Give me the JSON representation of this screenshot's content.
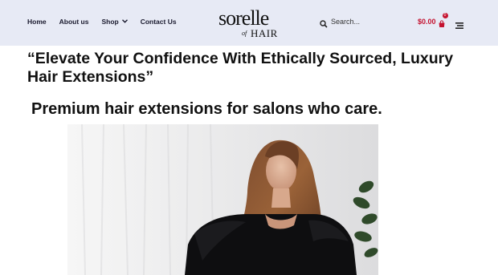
{
  "header": {
    "nav": [
      {
        "label": "Home"
      },
      {
        "label": "About us"
      },
      {
        "label": "Shop"
      },
      {
        "label": "Contact Us"
      }
    ],
    "logo": {
      "main": "sorelle",
      "of": "of",
      "hair": "HAIR"
    },
    "search": {
      "placeholder": "Search..."
    },
    "cart": {
      "amount": "$0.00",
      "count": "0"
    }
  },
  "main": {
    "quote": "“Elevate Your Confidence With Ethically Sourced, Luxury Hair Extensions”",
    "tagline": "Premium hair extensions for salons who care."
  },
  "colors": {
    "header_bg": "#e7eaf5",
    "accent": "#c4122f"
  },
  "icons": [
    "search-icon",
    "cart-icon",
    "chevron-down-icon",
    "menu-icon"
  ]
}
